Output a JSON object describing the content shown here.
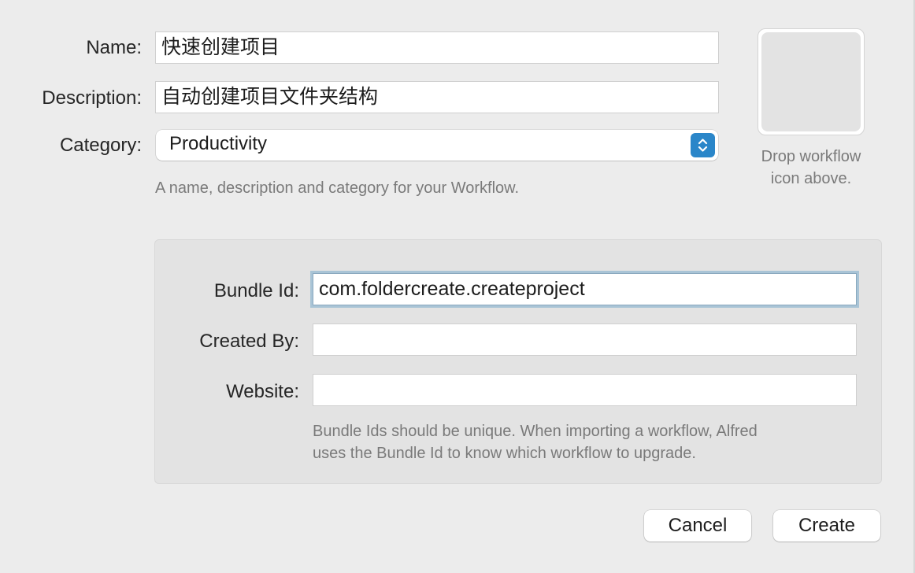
{
  "form": {
    "name_label": "Name:",
    "name_value": "快速创建项目",
    "description_label": "Description:",
    "description_value": "自动创建项目文件夹结构",
    "category_label": "Category:",
    "category_value": "Productivity",
    "hint": "A name, description and category for your Workflow."
  },
  "icon_well": {
    "caption_line1": "Drop workflow",
    "caption_line2": "icon above."
  },
  "bundle": {
    "bundle_id_label": "Bundle Id:",
    "bundle_id_value": "com.foldercreate.createproject",
    "created_by_label": "Created By:",
    "created_by_value": "",
    "website_label": "Website:",
    "website_value": "",
    "hint_line1": "Bundle Ids should be unique. When importing a workflow, Alfred",
    "hint_line2": "uses the Bundle Id to know which workflow to upgrade."
  },
  "buttons": {
    "cancel": "Cancel",
    "create": "Create"
  },
  "colors": {
    "accent": "#2a86c9",
    "focus_ring": "#a9c4d6",
    "background": "#ececec"
  },
  "icons": {
    "select_arrows": "chevron-up-down-icon"
  }
}
